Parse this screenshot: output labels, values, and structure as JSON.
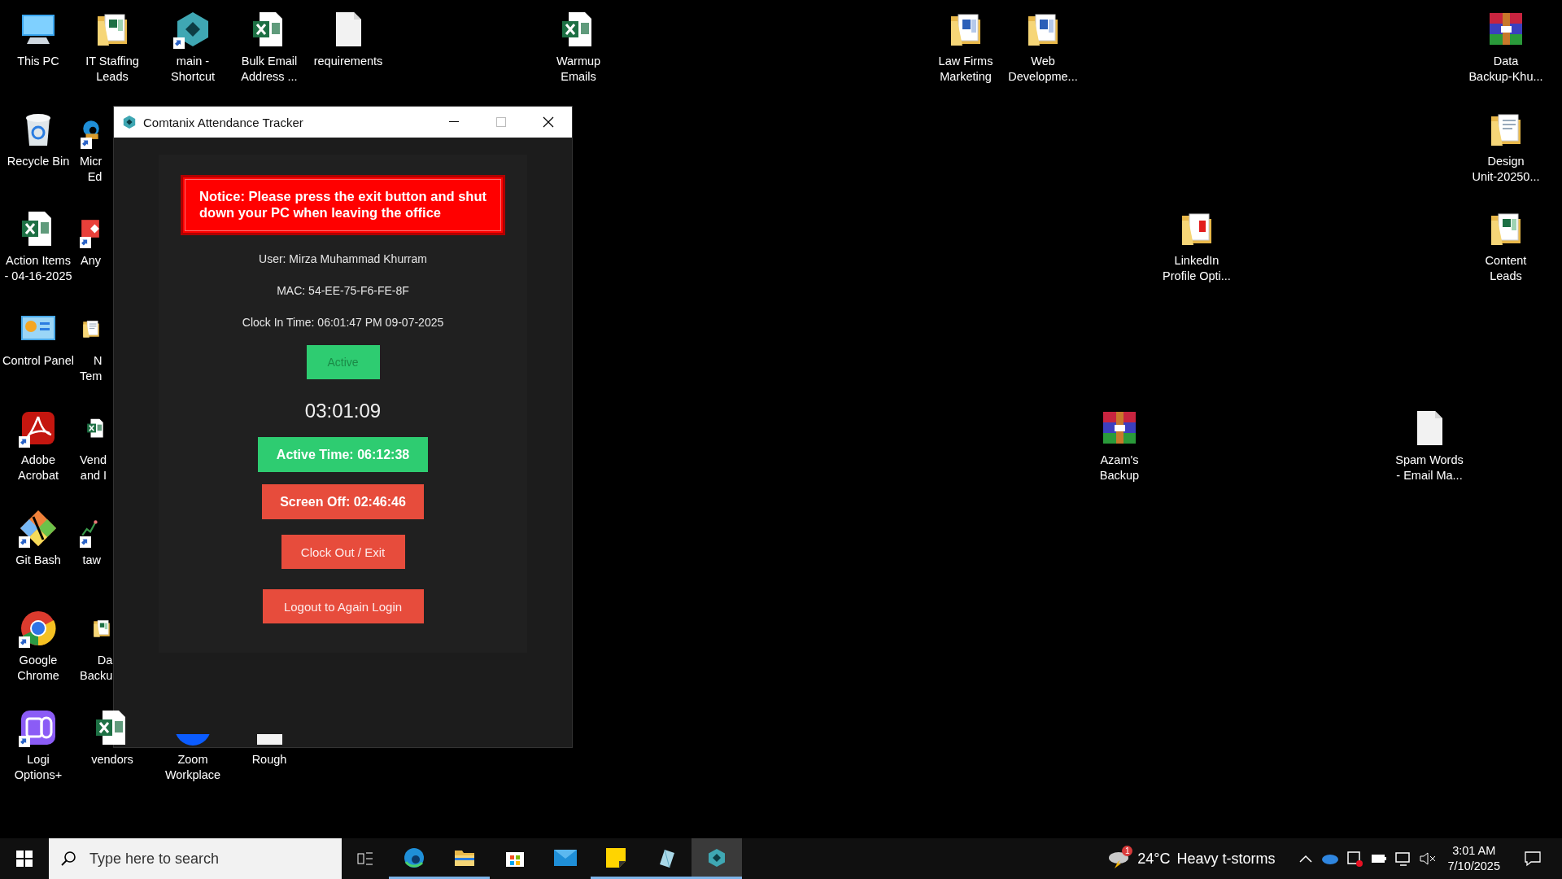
{
  "desktop_icons": [
    {
      "kind": "pc",
      "label": [
        "This PC"
      ],
      "shortcut": false
    },
    {
      "kind": "folder-sheet",
      "label": [
        "IT Staffing",
        "Leads"
      ],
      "shortcut": false
    },
    {
      "kind": "hex",
      "label": [
        "main -",
        "Shortcut"
      ],
      "shortcut": true
    },
    {
      "kind": "excel",
      "label": [
        "Bulk Email",
        "Address ..."
      ],
      "shortcut": false
    },
    {
      "kind": "doc",
      "label": [
        "requirements"
      ],
      "shortcut": false
    },
    {
      "kind": "excel",
      "label": [
        "Warmup",
        "Emails"
      ],
      "shortcut": false
    },
    {
      "kind": "folder-word",
      "label": [
        "Law Firms",
        "Marketing"
      ],
      "shortcut": false
    },
    {
      "kind": "folder-word",
      "label": [
        "Web",
        "Developme..."
      ],
      "shortcut": false
    },
    {
      "kind": "archive",
      "label": [
        "Data",
        "Backup-Khu..."
      ],
      "shortcut": false
    },
    {
      "kind": "recycle",
      "label": [
        "Recycle Bin"
      ],
      "shortcut": false
    },
    {
      "kind": "edge",
      "label": [
        "Micr",
        "Ed"
      ],
      "shortcut": true
    },
    {
      "kind": "folder-doc",
      "label": [
        "Design",
        "Unit-20250..."
      ],
      "shortcut": false
    },
    {
      "kind": "excel",
      "label": [
        "Action Items",
        "- 04-16-2025"
      ],
      "shortcut": false
    },
    {
      "kind": "remote",
      "label": [
        "Any"
      ],
      "shortcut": true
    },
    {
      "kind": "folder-pdf",
      "label": [
        "LinkedIn",
        "Profile Opti..."
      ],
      "shortcut": false
    },
    {
      "kind": "folder-sheet",
      "label": [
        "Content",
        "Leads"
      ],
      "shortcut": false
    },
    {
      "kind": "control",
      "label": [
        "Control Panel"
      ],
      "shortcut": false
    },
    {
      "kind": "folder-doc",
      "label": [
        "N",
        "Tem"
      ],
      "shortcut": false
    },
    {
      "kind": "acrobat",
      "label": [
        "Adobe",
        "Acrobat"
      ],
      "shortcut": true
    },
    {
      "kind": "excel",
      "label": [
        "Vend",
        "and I"
      ],
      "shortcut": false
    },
    {
      "kind": "archive",
      "label": [
        "Azam's",
        "Backup"
      ],
      "shortcut": false
    },
    {
      "kind": "doc",
      "label": [
        "Spam Words",
        "- Email Ma..."
      ],
      "shortcut": false
    },
    {
      "kind": "git",
      "label": [
        "Git Bash"
      ],
      "shortcut": true
    },
    {
      "kind": "chart",
      "label": [
        "taw"
      ],
      "shortcut": true
    },
    {
      "kind": "chrome",
      "label": [
        "Google",
        "Chrome"
      ],
      "shortcut": true
    },
    {
      "kind": "folder-sheet",
      "label": [
        "Da",
        "Backu"
      ],
      "shortcut": false
    },
    {
      "kind": "logi",
      "label": [
        "Logi",
        "Options+"
      ],
      "shortcut": true
    },
    {
      "kind": "excel",
      "label": [
        "vendors"
      ],
      "shortcut": false
    },
    {
      "kind": "zoom",
      "label": [
        "Zoom",
        "Workplace"
      ],
      "shortcut": false
    },
    {
      "kind": "doc",
      "label": [
        "Rough"
      ],
      "shortcut": false
    }
  ],
  "window": {
    "title": "Comtanix Attendance Tracker",
    "notice": "Notice: Please press the exit button and shut down your PC when leaving the office",
    "info_lines": [
      "User: Mirza Muhammad Khurram",
      "MAC: 54-EE-75-F6-FE-8F",
      "Clock In Time: 06:01:47 PM 09-07-2025"
    ],
    "status": {
      "label": "Active",
      "active": true
    },
    "timer": "03:01:09",
    "stats": [
      {
        "kind": "active",
        "label": "Active Time: 06:12:38"
      },
      {
        "kind": "off",
        "label": "Screen Off: 02:46:46"
      }
    ],
    "buttons": [
      "Clock Out / Exit",
      "Logout to Again Login"
    ]
  },
  "taskbar": {
    "search": {
      "placeholder": "Type here to search"
    },
    "apps": [
      {
        "kind": "edge",
        "running": true,
        "selected": false
      },
      {
        "kind": "explorer",
        "running": true,
        "selected": false
      },
      {
        "kind": "store",
        "running": false,
        "selected": false
      },
      {
        "kind": "mail",
        "running": false,
        "selected": false
      },
      {
        "kind": "sticky",
        "running": true,
        "selected": false
      },
      {
        "kind": "crystal",
        "running": true,
        "selected": false
      },
      {
        "kind": "hex",
        "running": true,
        "selected": true
      }
    ],
    "weather": {
      "badge": "1",
      "temperature": "24°C",
      "condition": "Heavy t-storms"
    },
    "clock": {
      "time": "3:01 AM",
      "date": "7/10/2025"
    }
  }
}
